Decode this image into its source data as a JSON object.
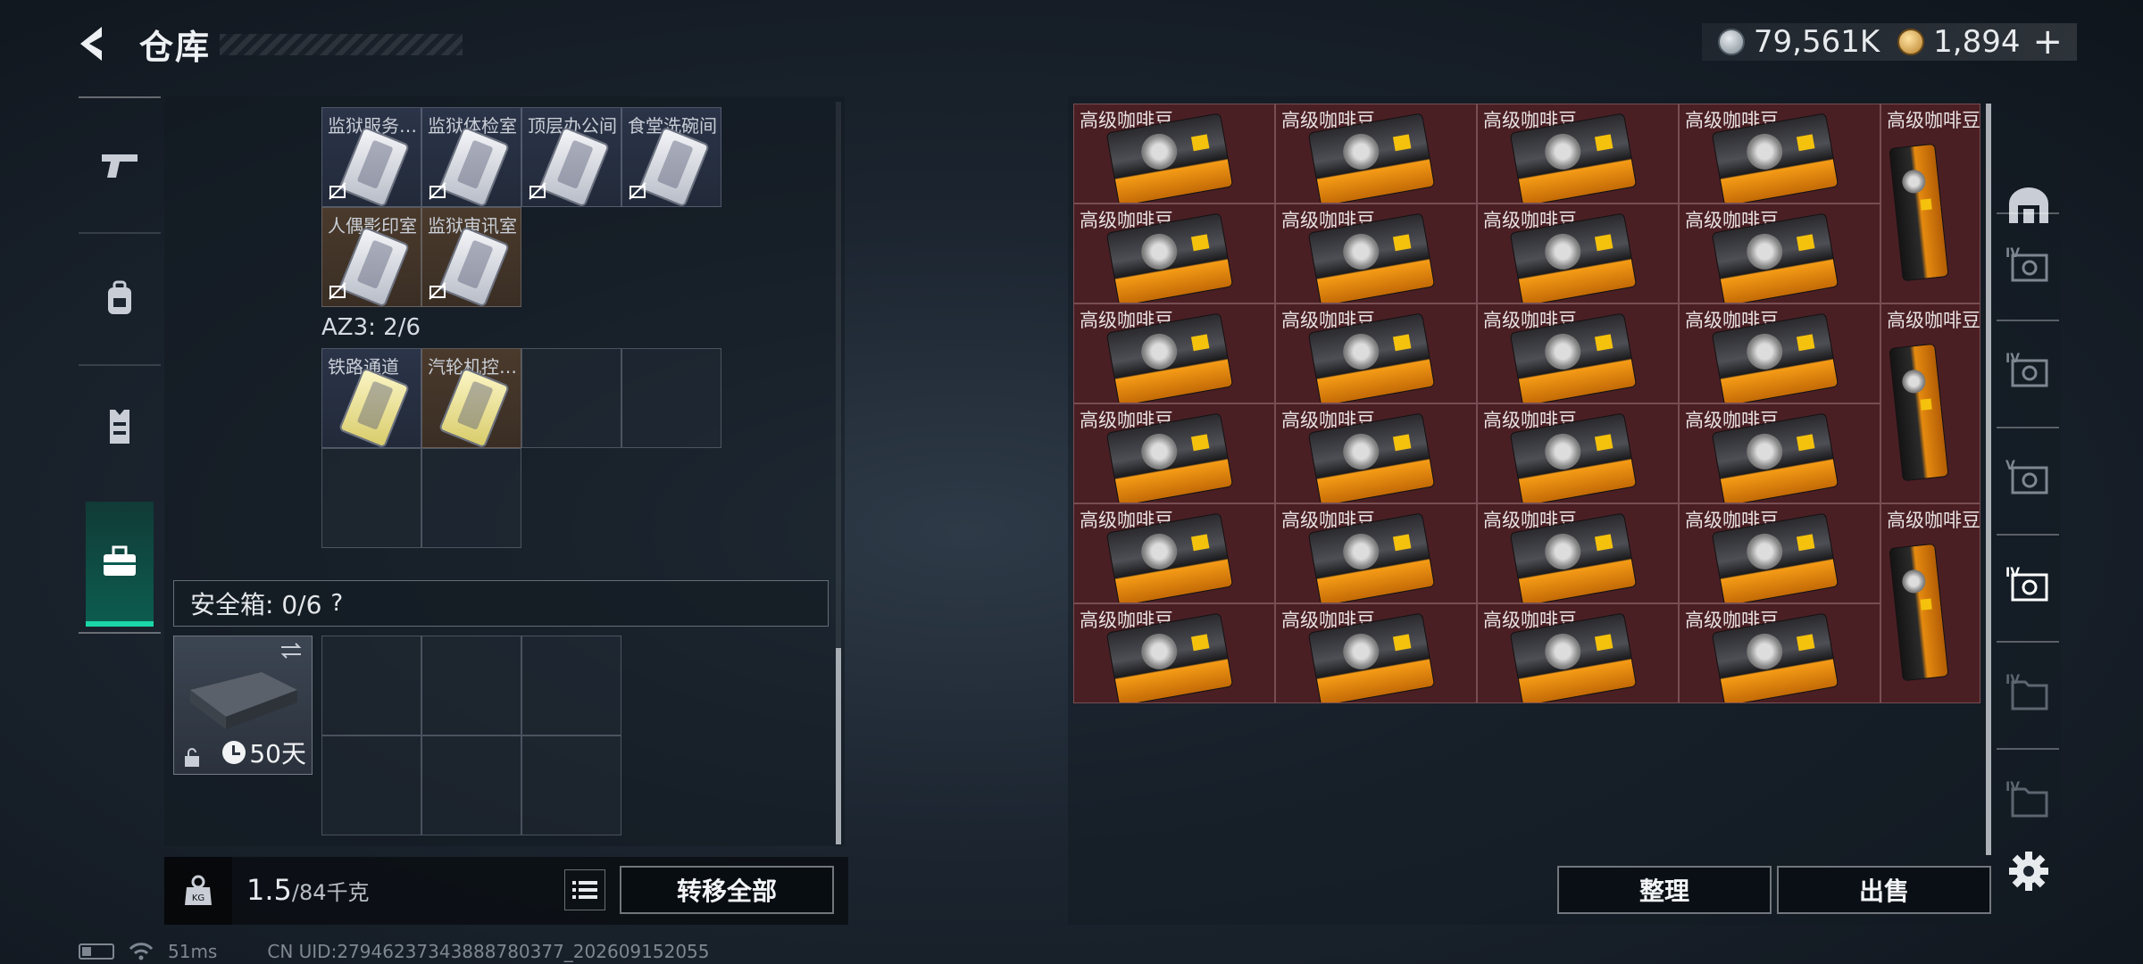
{
  "header": {
    "title": "仓库",
    "currency_silver": "79,561K",
    "currency_gold": "1,894",
    "plus": "+"
  },
  "left_nav": {
    "items": [
      {
        "name": "weapons",
        "icon": "pistol-icon"
      },
      {
        "name": "gear",
        "icon": "backpack-icon"
      },
      {
        "name": "vest",
        "icon": "vest-icon"
      },
      {
        "name": "items",
        "icon": "toolbox-icon",
        "active": true
      }
    ]
  },
  "keycards_top": [
    {
      "label": "监狱服务…",
      "color": "blue"
    },
    {
      "label": "监狱体检室",
      "color": "blue"
    },
    {
      "label": "顶层办公间",
      "color": "blue"
    },
    {
      "label": "食堂洗碗间",
      "color": "blue"
    },
    {
      "label": "人偶影印室",
      "color": "brown"
    },
    {
      "label": "监狱审讯室",
      "color": "brown"
    }
  ],
  "az3": {
    "label": "AZ3: 2/6",
    "cards": [
      {
        "label": "铁路通道",
        "color": "blue"
      },
      {
        "label": "汽轮机控…",
        "color": "brown"
      }
    ]
  },
  "safe_box": {
    "header": "安全箱: 0/6",
    "help": "?",
    "days": "50天"
  },
  "weight": {
    "current": "1.5",
    "max": "/84千克"
  },
  "buttons": {
    "transfer_all": "转移全部",
    "sort": "整理",
    "sell": "出售"
  },
  "stash_grid": {
    "item_label": "高级咖啡豆",
    "rows": 6,
    "cols": 4,
    "tall_items": 3
  },
  "status_bar": {
    "ping": "51ms",
    "uid": "CN UID:27946237343888780377_202609152055"
  },
  "right_tabs": [
    {
      "icon": "bunker-icon"
    },
    {
      "icon": "storage-iv-icon"
    },
    {
      "icon": "storage-iv-icon"
    },
    {
      "icon": "storage-v-icon"
    },
    {
      "icon": "storage-iv-icon",
      "active": true
    },
    {
      "icon": "folder-iv-icon"
    },
    {
      "icon": "folder-iv-icon"
    }
  ],
  "colors": {
    "accent": "#1bd6a8",
    "item_bg": "#4a1f24",
    "slot_blue": "#2b3448",
    "slot_brown": "#4a3a2c"
  }
}
